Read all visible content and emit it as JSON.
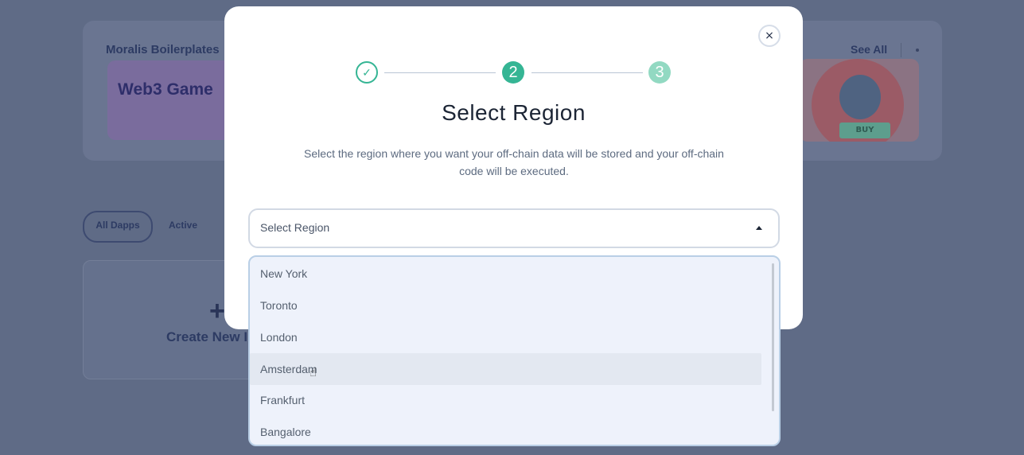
{
  "background": {
    "section_title": "Moralis Boilerplates",
    "tile_text": "Web3 Game",
    "see_all": "See All",
    "art_badge": "BUY",
    "filters": [
      "All Dapps",
      "Active"
    ],
    "create_label": "Create New I"
  },
  "modal": {
    "title": "Select Region",
    "description": "Select the region where you want your off-chain data will be stored and your off-chain code will be executed.",
    "steps": [
      {
        "label": "✓",
        "state": "completed"
      },
      {
        "label": "2",
        "state": "active"
      },
      {
        "label": "3",
        "state": "pending"
      }
    ],
    "close_label": "×",
    "select": {
      "placeholder": "Select Region",
      "options": [
        "New York",
        "Toronto",
        "London",
        "Amsterdam",
        "Frankfurt",
        "Bangalore"
      ],
      "hovered": "Amsterdam"
    }
  },
  "colors": {
    "accent": "#35b594",
    "accent_light": "#92d9c2",
    "overlay": "#5f6b86",
    "dropdown_bg": "#eef2fb"
  }
}
